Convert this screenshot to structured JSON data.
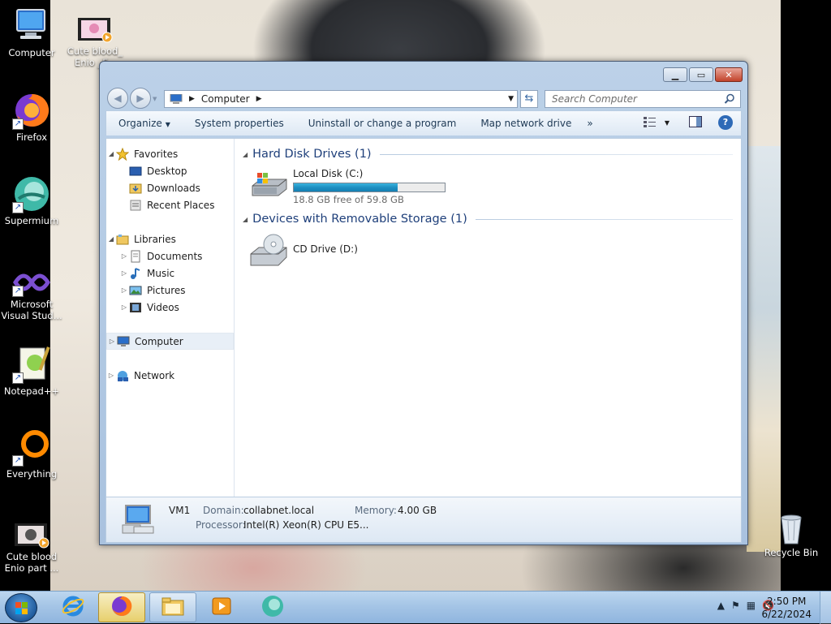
{
  "desktop": {
    "icons": [
      {
        "label": "Computer",
        "icon": "computer-icon"
      },
      {
        "label": "Cute blood_ Enio _F...",
        "icon": "video-file-icon"
      },
      {
        "label": "Firefox",
        "icon": "firefox-icon"
      },
      {
        "label": "Supermium",
        "icon": "supermium-icon"
      },
      {
        "label": "Microsoft Visual Stud...",
        "icon": "visual-studio-icon"
      },
      {
        "label": "Notepad++",
        "icon": "notepadpp-icon"
      },
      {
        "label": "Everything",
        "icon": "everything-icon"
      },
      {
        "label": "Cute blood Enio part ...",
        "icon": "video-file-icon"
      },
      {
        "label": "Recycle Bin",
        "icon": "recycle-bin-icon"
      }
    ]
  },
  "window": {
    "address": {
      "crumb": "Computer"
    },
    "search": {
      "placeholder": "Search Computer"
    },
    "toolbar": {
      "organize": "Organize",
      "system_properties": "System properties",
      "uninstall": "Uninstall or change a program",
      "map_drive": "Map network drive",
      "more": "»"
    },
    "nav": {
      "favorites": "Favorites",
      "desktop": "Desktop",
      "downloads": "Downloads",
      "recent": "Recent Places",
      "libraries": "Libraries",
      "documents": "Documents",
      "music": "Music",
      "pictures": "Pictures",
      "videos": "Videos",
      "computer": "Computer",
      "network": "Network"
    },
    "groups": {
      "hdd": "Hard Disk Drives (1)",
      "removable": "Devices with Removable Storage (1)"
    },
    "drives": {
      "c_name": "Local Disk (C:)",
      "c_free": "18.8 GB free of 59.8 GB",
      "c_used_fraction": 0.686,
      "d_name": "CD Drive (D:)"
    },
    "details": {
      "name": "VM1",
      "domain_label": "Domain:",
      "domain": "collabnet.local",
      "memory_label": "Memory:",
      "memory": "4.00 GB",
      "processor_label": "Processor:",
      "processor": "Intel(R) Xeon(R) CPU E5..."
    }
  },
  "taskbar": {
    "clock_time": "2:50 PM",
    "clock_date": "6/22/2024"
  }
}
